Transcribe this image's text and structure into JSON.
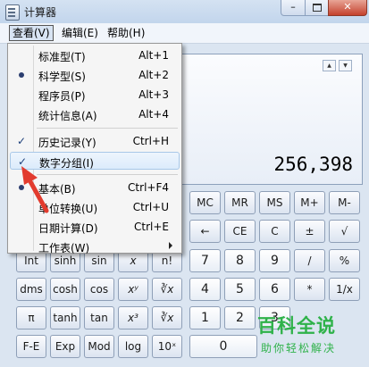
{
  "window": {
    "title": "计算器",
    "min_label": "–",
    "close_label": "✕"
  },
  "menubar": {
    "view": "查看(V)",
    "edit": "编辑(E)",
    "help": "帮助(H)"
  },
  "display": {
    "value": "256,398",
    "up_arrow": "▲",
    "down_arrow": "▼"
  },
  "view_menu": {
    "items": [
      {
        "label": "标准型(T)",
        "shortcut": "Alt+1"
      },
      {
        "label": "科学型(S)",
        "shortcut": "Alt+2",
        "selected": true
      },
      {
        "label": "程序员(P)",
        "shortcut": "Alt+3"
      },
      {
        "label": "统计信息(A)",
        "shortcut": "Alt+4"
      },
      {
        "label": "历史记录(Y)",
        "shortcut": "Ctrl+H",
        "checked": true
      },
      {
        "label": "数字分组(I)",
        "shortcut": "",
        "checked": true,
        "highlighted": true
      },
      {
        "label": "基本(B)",
        "shortcut": "Ctrl+F4",
        "selected": true
      },
      {
        "label": "单位转换(U)",
        "shortcut": "Ctrl+U"
      },
      {
        "label": "日期计算(D)",
        "shortcut": "Ctrl+E"
      },
      {
        "label": "工作表(W)",
        "shortcut": "",
        "submenu": true
      }
    ],
    "check_mark": "✓"
  },
  "buttons": {
    "row1": [
      "MC",
      "MR",
      "MS",
      "M+",
      "M-"
    ],
    "row2": [
      "←",
      "CE",
      "C",
      "±",
      "√"
    ],
    "row3_left": [
      "Int",
      "sinh",
      "sin",
      "x",
      "n!"
    ],
    "row3_right": [
      "7",
      "8",
      "9",
      "/",
      "%"
    ],
    "row4_left": [
      "dms",
      "cosh",
      "cos",
      "xʸ",
      "∛x"
    ],
    "row4_right": [
      "4",
      "5",
      "6",
      "*",
      "1/x"
    ],
    "row5_left": [
      "π",
      "tanh",
      "tan",
      "x³",
      "∛x"
    ],
    "row5_right": [
      "1",
      "2",
      "3"
    ],
    "row6_left": [
      "F-E",
      "Exp",
      "Mod",
      "log",
      "10ˣ"
    ],
    "row6_right": [
      "0"
    ]
  },
  "watermark": {
    "top": "百科全说",
    "bottom": "助你轻松解决"
  },
  "colors": {
    "accent_red": "#e23b2e",
    "watermark_green": "#2fb24a"
  }
}
